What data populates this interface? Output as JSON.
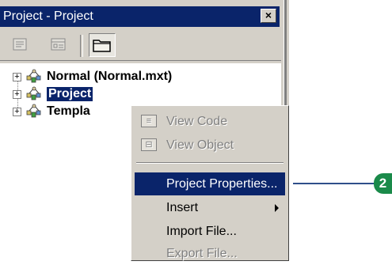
{
  "window": {
    "title": "Project - Project",
    "close_glyph": "×"
  },
  "toolbar": {
    "buttons": [
      "view-code-icon",
      "view-object-icon",
      "toggle-folders-icon"
    ]
  },
  "tree": {
    "nodes": [
      {
        "label": "Normal (Normal.mxt)",
        "expander": "+",
        "selected": false
      },
      {
        "label": "Project",
        "expander": "+",
        "selected": true
      },
      {
        "label": "Templa",
        "expander": "+",
        "selected": false
      }
    ]
  },
  "context_menu": {
    "items": [
      {
        "label": "View Code",
        "enabled": false,
        "icon": "view-code-icon"
      },
      {
        "label": "View Object",
        "enabled": false,
        "icon": "view-object-icon"
      },
      {
        "label": "Project Properties...",
        "enabled": true,
        "highlighted": true
      },
      {
        "label": "Insert",
        "enabled": true,
        "submenu": true
      },
      {
        "label": "Import File...",
        "enabled": true
      },
      {
        "label": "Export File...",
        "enabled": false
      }
    ]
  },
  "callout": {
    "number": "2",
    "color": "#1a8a4a"
  },
  "colors": {
    "selection": "#0a246a",
    "face": "#d4d0c8"
  }
}
